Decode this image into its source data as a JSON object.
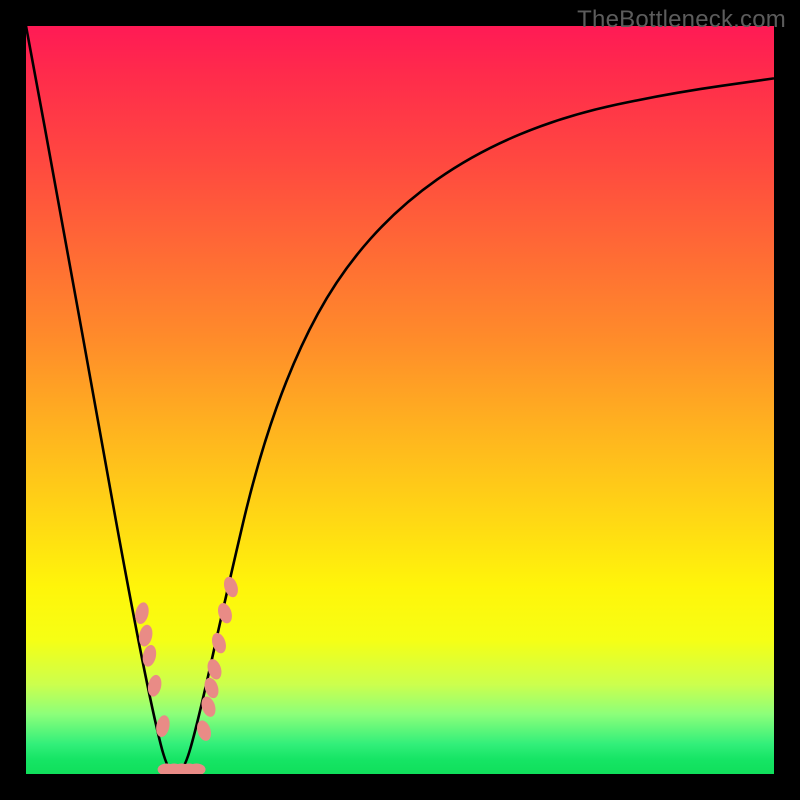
{
  "watermark": "TheBottleneck.com",
  "chart_data": {
    "type": "line",
    "title": "",
    "xlabel": "",
    "ylabel": "",
    "xlim": [
      0,
      1
    ],
    "ylim": [
      0,
      1
    ],
    "series": [
      {
        "name": "bottleneck-curve",
        "x": [
          0.0,
          0.05,
          0.1,
          0.14,
          0.17,
          0.19,
          0.21,
          0.23,
          0.27,
          0.31,
          0.36,
          0.42,
          0.5,
          0.6,
          0.72,
          0.86,
          1.0
        ],
        "y": [
          1.0,
          0.73,
          0.45,
          0.23,
          0.08,
          0.0,
          0.0,
          0.07,
          0.25,
          0.42,
          0.56,
          0.67,
          0.76,
          0.83,
          0.88,
          0.91,
          0.93
        ]
      }
    ],
    "markers": {
      "name": "highlighted-points",
      "left_branch_x": [
        0.155,
        0.16,
        0.165,
        0.172,
        0.183
      ],
      "left_branch_y": [
        0.215,
        0.185,
        0.158,
        0.118,
        0.064
      ],
      "bottom_x": [
        0.188,
        0.198,
        0.208,
        0.218,
        0.228
      ],
      "bottom_y": [
        0.0,
        0.0,
        0.0,
        0.0,
        0.0
      ],
      "right_branch_x": [
        0.238,
        0.244,
        0.248,
        0.252,
        0.258,
        0.266,
        0.274
      ],
      "right_branch_y": [
        0.058,
        0.09,
        0.115,
        0.14,
        0.175,
        0.215,
        0.25
      ]
    },
    "gradient_stops": [
      {
        "pos": 0.0,
        "color": "#ff1a55"
      },
      {
        "pos": 0.5,
        "color": "#ffc91a"
      },
      {
        "pos": 0.8,
        "color": "#f6ff14"
      },
      {
        "pos": 1.0,
        "color": "#10df5b"
      }
    ]
  }
}
